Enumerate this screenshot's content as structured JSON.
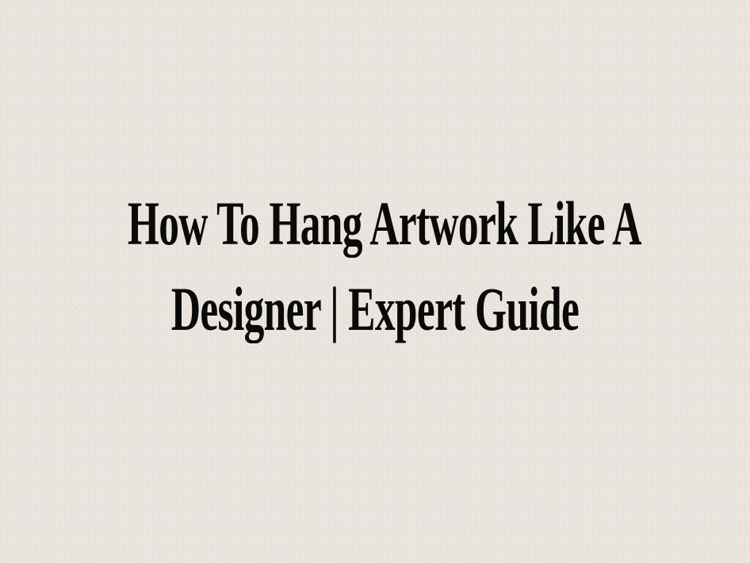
{
  "background": {
    "color": "#ece6e0",
    "texture": "linen"
  },
  "title": {
    "line1": "How To Hang Artwork Like A",
    "line2": "Designer | Expert Guide",
    "color": "#0a0a0a"
  }
}
